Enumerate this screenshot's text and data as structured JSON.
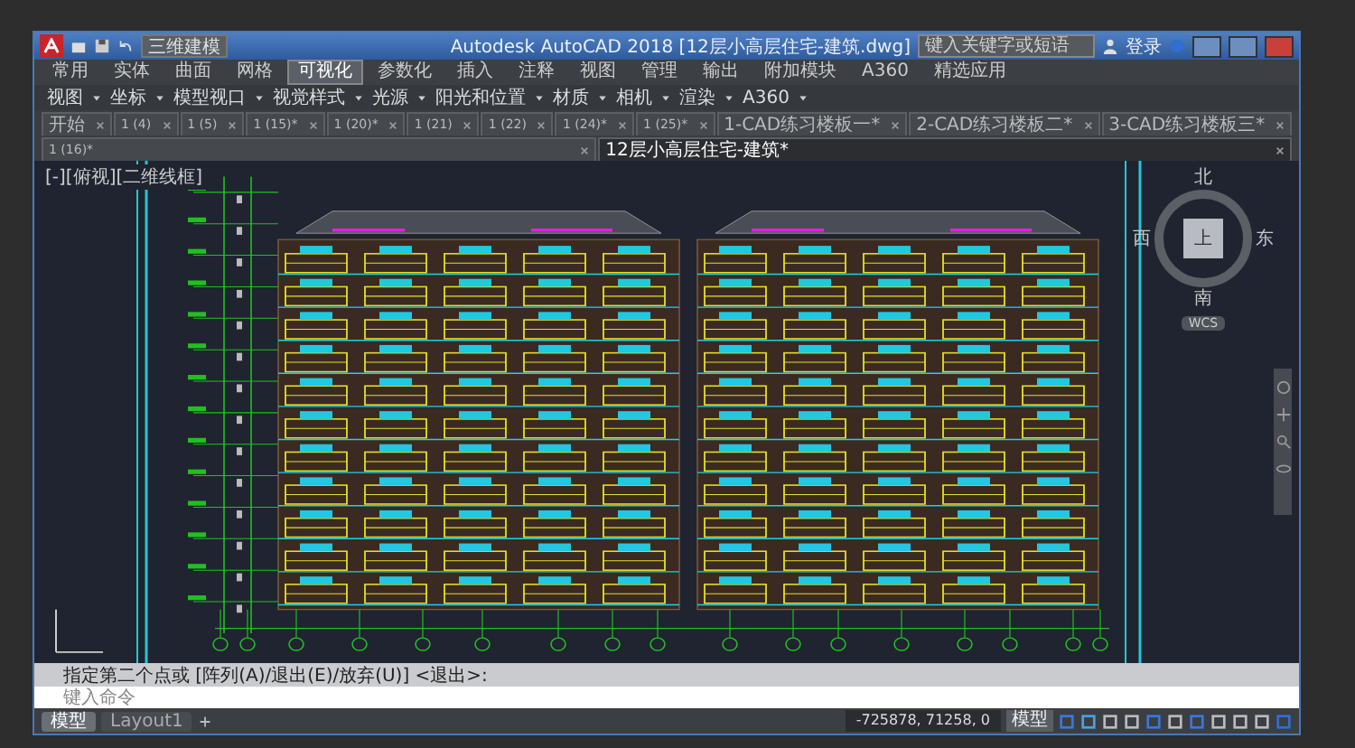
{
  "window": {
    "title": "Autodesk AutoCAD 2018",
    "file": "[12层小高层住宅-建筑.dwg]",
    "workspace": "三维建模",
    "search": {
      "placeholder": "键入关键字或短语"
    },
    "login": "登录"
  },
  "ribbon_tabs": [
    {
      "label": "常用",
      "selected": false
    },
    {
      "label": "实体",
      "selected": false
    },
    {
      "label": "曲面",
      "selected": false
    },
    {
      "label": "网格",
      "selected": false
    },
    {
      "label": "可视化",
      "selected": true
    },
    {
      "label": "参数化",
      "selected": false
    },
    {
      "label": "插入",
      "selected": false
    },
    {
      "label": "注释",
      "selected": false
    },
    {
      "label": "视图",
      "selected": false
    },
    {
      "label": "管理",
      "selected": false
    },
    {
      "label": "输出",
      "selected": false
    },
    {
      "label": "附加模块",
      "selected": false
    },
    {
      "label": "A360",
      "selected": false
    },
    {
      "label": "精选应用",
      "selected": false
    }
  ],
  "panels": [
    "视图",
    "坐标",
    "模型视口",
    "视觉样式",
    "光源",
    "阳光和位置",
    "材质",
    "相机",
    "渲染",
    "A360"
  ],
  "file_tabs": [
    {
      "label": "开始",
      "selected": false
    },
    {
      "label": "1 (4)",
      "selected": false
    },
    {
      "label": "1 (5)",
      "selected": false
    },
    {
      "label": "1 (15)*",
      "selected": false
    },
    {
      "label": "1 (20)*",
      "selected": false
    },
    {
      "label": "1 (21)",
      "selected": false
    },
    {
      "label": "1 (22)",
      "selected": false
    },
    {
      "label": "1 (24)*",
      "selected": false
    },
    {
      "label": "1 (25)*",
      "selected": false
    },
    {
      "label": "1-CAD练习楼板一*",
      "selected": false
    },
    {
      "label": "2-CAD练习楼板二*",
      "selected": false
    },
    {
      "label": "3-CAD练习楼板三*",
      "selected": false
    },
    {
      "label": "1 (16)*",
      "selected": false
    },
    {
      "label": "12层小高层住宅-建筑*",
      "selected": true
    }
  ],
  "viewport": {
    "label": "[-][俯视][二维线框]"
  },
  "viewcube": {
    "north": "北",
    "south": "南",
    "east": "东",
    "west": "西",
    "face": "上",
    "ucs": "WCS"
  },
  "command": {
    "history": "指定第二个点或 [阵列(A)/退出(E)/放弃(U)] <退出>:",
    "placeholder": "键入命令"
  },
  "layout_tabs": [
    {
      "label": "模型",
      "selected": true
    },
    {
      "label": "Layout1",
      "selected": false
    }
  ],
  "status": {
    "coordinates": "-725878, 71258, 0",
    "mode": "模型"
  }
}
